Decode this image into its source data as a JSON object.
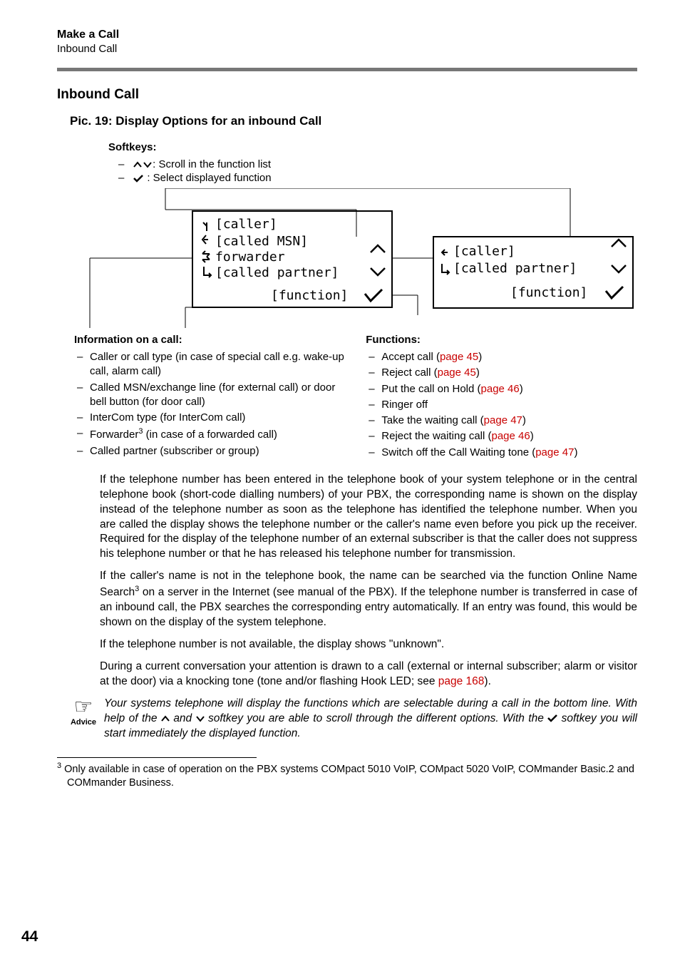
{
  "header": {
    "title": "Make a Call",
    "sub": "Inbound Call"
  },
  "section_heading": "Inbound Call",
  "pic_caption": "Pic. 19: Display Options for an inbound Call",
  "softkeys": {
    "title": "Softkeys:",
    "line1": ": Scroll in the function list",
    "line2": " : Select displayed function"
  },
  "display_left": {
    "l1": "[caller]",
    "l2": "[called MSN]",
    "l3": "forwarder",
    "l4": "[called partner]",
    "l5": "[function]"
  },
  "display_right": {
    "l1": "[caller]",
    "l2": "[called partner]",
    "l3": "[function]"
  },
  "info": {
    "title": "Information on a call:",
    "i1": "Caller or call type (in case of special call e.g. wake-up call, alarm call)",
    "i2": "Called MSN/exchange line (for external call) or door bell button (for door call)",
    "i3": "InterCom type (for InterCom call)",
    "i4a": "Forwarder",
    "i4b": " (in case of a forwarded call)",
    "i5": "Called partner (subscriber or group)"
  },
  "functions": {
    "title": "Functions:",
    "f1a": "Accept call (",
    "f1b": "page 45",
    "f1c": ")",
    "f2a": "Reject call (",
    "f2b": "page 45",
    "f2c": ")",
    "f3a": "Put the call on Hold (",
    "f3b": "page 46",
    "f3c": ")",
    "f4": "Ringer off",
    "f5a": "Take the waiting call (",
    "f5b": "page 47",
    "f5c": ")",
    "f6a": "Reject the waiting call (",
    "f6b": "page 46",
    "f6c": ")",
    "f7a": "Switch off the Call Waiting tone (",
    "f7b": "page 47",
    "f7c": ")"
  },
  "body": {
    "p1": "If the telephone number has been entered in the telephone book of your system telephone or in the central telephone book (short-code dialling numbers) of your PBX, the corresponding name is shown on the display instead of the telephone number as soon as the telephone has identified the telephone number. When you are called the display shows the telephone number or the caller's name even before you pick up the receiver. Required for the display of the telephone number of an external subscriber is that the caller does not suppress his telephone number or that he has released his telephone number for transmission.",
    "p2a": "If the caller's name is not in the telephone book, the name can be searched via the function Online Name Search",
    "p2b": " on a server in the Internet (see manual of the PBX). If the telephone number is transferred in case of an inbound call, the PBX searches the corresponding entry automatically. If an entry was found, this would be shown on the display of the system telephone.",
    "p3": "If the telephone number is not available, the display shows \"unknown\".",
    "p4a": "During a current conversation your attention is drawn to a call (external or internal subscriber; alarm or visitor at the door) via a knocking tone (tone and/or flashing Hook LED; see ",
    "p4b": "page 168",
    "p4c": ")."
  },
  "advice": {
    "label": "Advice",
    "t1": "Your systems telephone will display the functions which are selectable during a call in the bottom line. With help of the ",
    "t2": " and ",
    "t3": " softkey you are able to scroll through the different options. With the ",
    "t4": " softkey you will start immediately the displayed function."
  },
  "footnote": {
    "num": "3",
    "text": " Only available in case of operation on the PBX systems COMpact 5010 VoIP, COMpact 5020 VoIP, COMmander Basic.2 and COMmander Business."
  },
  "page_number": "44"
}
